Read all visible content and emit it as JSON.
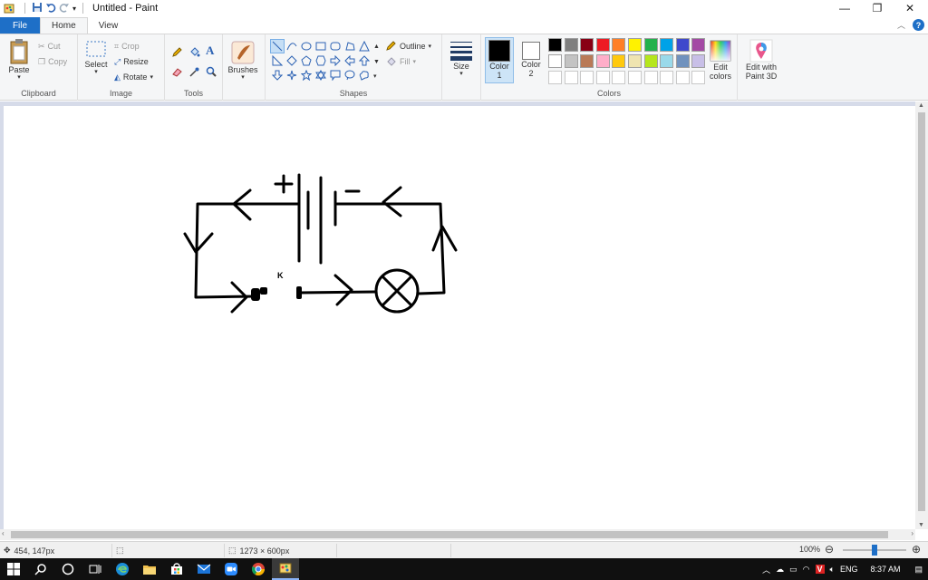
{
  "window": {
    "title": "Untitled - Paint",
    "controls": {
      "minimize": "—",
      "maximize": "❐",
      "close": "✕"
    }
  },
  "tabs": [
    {
      "label": "File"
    },
    {
      "label": "Home"
    },
    {
      "label": "View"
    }
  ],
  "ribbon": {
    "clipboard": {
      "label": "Clipboard",
      "paste": "Paste",
      "cut": "Cut",
      "copy": "Copy"
    },
    "image": {
      "label": "Image",
      "select": "Select",
      "crop": "Crop",
      "resize": "Resize",
      "rotate": "Rotate"
    },
    "tools": {
      "label": "Tools"
    },
    "brushes": {
      "label": "Brushes"
    },
    "shapes": {
      "label": "Shapes",
      "outline": "Outline",
      "fill": "Fill"
    },
    "size": {
      "label": "Size"
    },
    "colors": {
      "label": "Colors",
      "color1_label": "Color",
      "color1_num": "1",
      "color2_label": "Color",
      "color2_num": "2",
      "color1": "#000000",
      "color2": "#ffffff",
      "palette_row1": [
        "#000000",
        "#7f7f7f",
        "#880015",
        "#ed1c24",
        "#ff7f27",
        "#fff200",
        "#22b14c",
        "#00a2e8",
        "#3f48cc",
        "#a349a4"
      ],
      "palette_row2": [
        "#ffffff",
        "#c3c3c3",
        "#b97a57",
        "#ffaec9",
        "#ffc90e",
        "#efe4b0",
        "#b5e61d",
        "#99d9ea",
        "#7092be",
        "#c8bfe7"
      ],
      "palette_row3": [
        "#ffffff",
        "#ffffff",
        "#ffffff",
        "#ffffff",
        "#ffffff",
        "#ffffff",
        "#ffffff",
        "#ffffff",
        "#ffffff",
        "#ffffff"
      ],
      "edit_colors_line1": "Edit",
      "edit_colors_line2": "colors"
    },
    "paint3d": {
      "line1": "Edit with",
      "line2": "Paint 3D"
    }
  },
  "drawing": {
    "switch_label": "K",
    "battery_plus": "+",
    "battery_minus": "−"
  },
  "statusbar": {
    "cursor_position": "454, 147px",
    "canvas_size": "1273 × 600px",
    "zoom": "100%",
    "zoom_level": 0.5
  },
  "taskbar": {
    "language": "ENG",
    "time": "8:37 AM"
  }
}
